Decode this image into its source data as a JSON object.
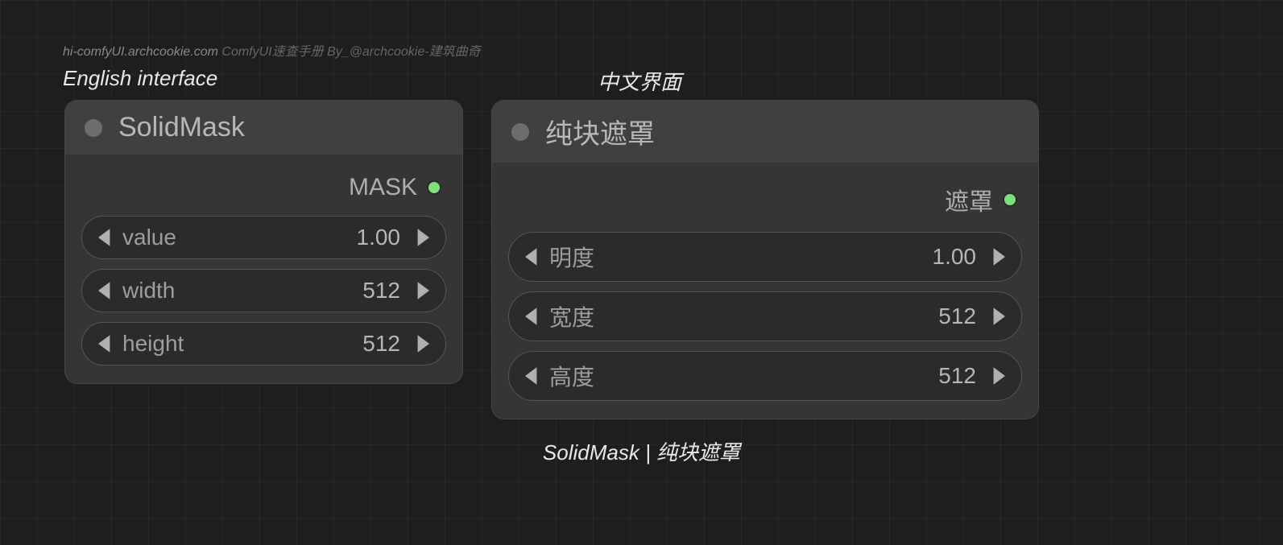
{
  "header": {
    "site": "hi-comfyUI.archcookie.com",
    "desc": " ComfyUI速查手册 By_@archcookie-建筑曲奇"
  },
  "sections": {
    "en_title": "English interface",
    "zh_title": "中文界面"
  },
  "node_en": {
    "title": "SolidMask",
    "output": "MASK",
    "params": [
      {
        "label": "value",
        "value": "1.00"
      },
      {
        "label": "width",
        "value": "512"
      },
      {
        "label": "height",
        "value": "512"
      }
    ]
  },
  "node_zh": {
    "title": "纯块遮罩",
    "output": "遮罩",
    "params": [
      {
        "label": "明度",
        "value": "1.00"
      },
      {
        "label": "宽度",
        "value": "512"
      },
      {
        "label": "高度",
        "value": "512"
      }
    ]
  },
  "caption": "SolidMask | 纯块遮罩"
}
